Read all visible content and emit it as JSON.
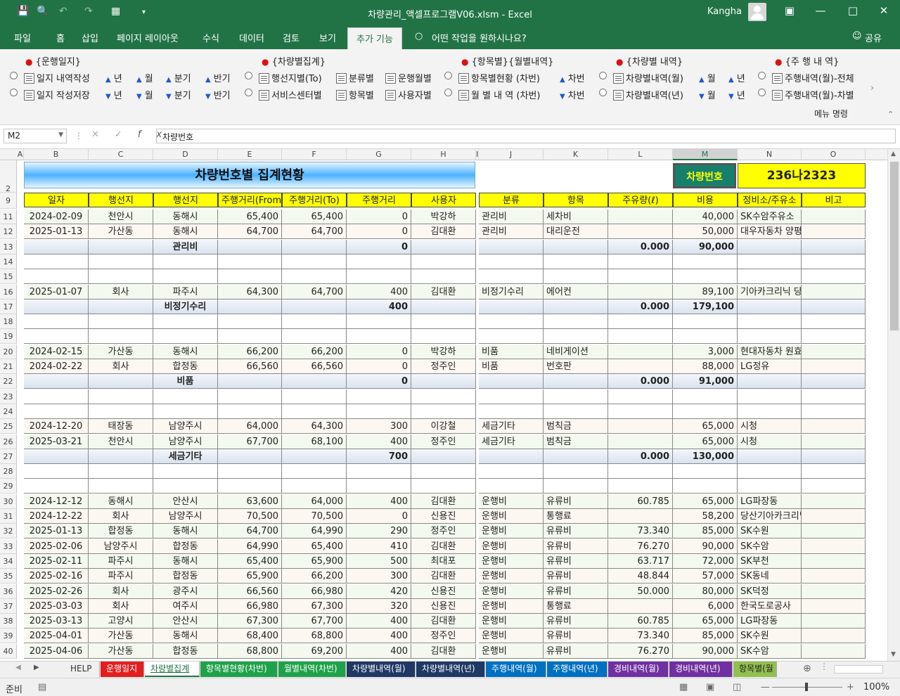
{
  "window": {
    "title": "차량관리_액셀프로그램V06.xlsm  -  Excel",
    "user": "Kangha"
  },
  "menu": {
    "tabs": [
      "파일",
      "홈",
      "삽입",
      "페이지 레이아웃",
      "수식",
      "데이터",
      "검토",
      "보기",
      "추가 기능"
    ],
    "active_tab": "추가 기능",
    "tell_me": "어떤 작업을 원하시나요?",
    "share": "공유"
  },
  "ribbon": {
    "groups": {
      "g1": "{운행일지}",
      "g2": "{차량별집계}",
      "g3": "{항목별}{월별내역}",
      "g4": "{차량별 내역}",
      "g5": "{주 행 내 역}"
    },
    "items": {
      "daily_write": "일지 내역작성",
      "daily_save": "일지 작성저장",
      "year": "년",
      "month": "월",
      "quarter": "분기",
      "half": "반기",
      "by_route_to": "행선지별(To)",
      "by_service": "서비스센터별",
      "by_class": "분류별",
      "by_item": "항목별",
      "by_run_month": "운행월별",
      "by_user": "사용자별",
      "item_status": "항목별현황 (차번)",
      "monthly_detail": "월 별 내 역 (차번)",
      "car_no": "차번",
      "car_monthly": "차량별내역(월)",
      "car_yearly": "차량별내역(년)",
      "run_month_all": "주행내역(월)-전체",
      "run_month_car": "주행내역(월)-차별"
    },
    "footer": "메뉴 명령"
  },
  "formula": {
    "namebox": "M2",
    "content": "차량번호"
  },
  "sheet": {
    "columns": [
      "A",
      "B",
      "C",
      "D",
      "E",
      "F",
      "G",
      "H",
      "I",
      "J",
      "K",
      "L",
      "M",
      "N",
      "O"
    ],
    "selected_column": "M",
    "title": "차량번호별 집계현황",
    "car_label": "차량번호",
    "car_value": "236나2323",
    "headers": [
      "일자",
      "행선지",
      "행선지",
      "주행거리(From)",
      "주행거리(To)",
      "주행거리",
      "사용자",
      "분류",
      "항목",
      "주유량(ℓ)",
      "비용",
      "정비소/주유소",
      "비고"
    ],
    "rows": [
      {
        "n": "11",
        "t": "d",
        "z": "a",
        "v": [
          "2024-02-09",
          "천안시",
          "동해시",
          "65,400",
          "65,400",
          "0",
          "박강하",
          "관리비",
          "세차비",
          "",
          "40,000",
          "SK수암주유소",
          ""
        ]
      },
      {
        "n": "12",
        "t": "d",
        "z": "b",
        "v": [
          "2025-01-13",
          "가산동",
          "동해시",
          "64,700",
          "64,700",
          "0",
          "김대환",
          "관리비",
          "대리운전",
          "",
          "50,000",
          "대우자동차 양평동",
          ""
        ]
      },
      {
        "n": "13",
        "t": "s",
        "v": [
          "",
          "",
          "관리비",
          "",
          "",
          "0",
          "",
          "",
          "",
          "0.000",
          "90,000",
          "",
          ""
        ]
      },
      {
        "n": "14",
        "t": "e"
      },
      {
        "n": "15",
        "t": "e"
      },
      {
        "n": "16",
        "t": "d",
        "z": "a",
        "v": [
          "2025-01-07",
          "회사",
          "파주시",
          "64,300",
          "64,700",
          "400",
          "김대환",
          "비정기수리",
          "에어컨",
          "",
          "89,100",
          "기아카크리닉 당산점",
          ""
        ]
      },
      {
        "n": "17",
        "t": "s",
        "v": [
          "",
          "",
          "비정기수리",
          "",
          "",
          "400",
          "",
          "",
          "",
          "0.000",
          "179,100",
          "",
          ""
        ]
      },
      {
        "n": "18",
        "t": "e"
      },
      {
        "n": "19",
        "t": "e"
      },
      {
        "n": "20",
        "t": "d",
        "z": "a",
        "v": [
          "2024-02-15",
          "가산동",
          "동해시",
          "66,200",
          "66,200",
          "0",
          "박강하",
          "비품",
          "네비게이션",
          "",
          "3,000",
          "현대자동차 원효로",
          ""
        ]
      },
      {
        "n": "21",
        "t": "d",
        "z": "b",
        "v": [
          "2024-02-22",
          "회사",
          "합정동",
          "66,560",
          "66,560",
          "0",
          "정주인",
          "비품",
          "번호판",
          "",
          "88,000",
          "LG정유",
          ""
        ]
      },
      {
        "n": "22",
        "t": "s",
        "v": [
          "",
          "",
          "비품",
          "",
          "",
          "0",
          "",
          "",
          "",
          "0.000",
          "91,000",
          "",
          ""
        ]
      },
      {
        "n": "23",
        "t": "e"
      },
      {
        "n": "24",
        "t": "e"
      },
      {
        "n": "25",
        "t": "d",
        "z": "b",
        "v": [
          "2024-12-20",
          "태장동",
          "남양주시",
          "64,000",
          "64,300",
          "300",
          "이강철",
          "세금기타",
          "범칙금",
          "",
          "65,000",
          "시청",
          ""
        ]
      },
      {
        "n": "26",
        "t": "d",
        "z": "a",
        "v": [
          "2025-03-21",
          "천안시",
          "남양주시",
          "67,700",
          "68,100",
          "400",
          "정주인",
          "세금기타",
          "범칙금",
          "",
          "65,000",
          "시청",
          ""
        ]
      },
      {
        "n": "27",
        "t": "s",
        "v": [
          "",
          "",
          "세금기타",
          "",
          "",
          "700",
          "",
          "",
          "",
          "0.000",
          "130,000",
          "",
          ""
        ]
      },
      {
        "n": "28",
        "t": "e"
      },
      {
        "n": "29",
        "t": "e"
      },
      {
        "n": "30",
        "t": "d",
        "z": "a",
        "v": [
          "2024-12-12",
          "동해시",
          "안산시",
          "63,600",
          "64,000",
          "400",
          "김대환",
          "운행비",
          "유류비",
          "60.785",
          "65,000",
          "LG파장동",
          ""
        ]
      },
      {
        "n": "31",
        "t": "d",
        "z": "b",
        "v": [
          "2024-12-22",
          "회사",
          "남양주시",
          "70,500",
          "70,500",
          "0",
          "신용진",
          "운행비",
          "통행료",
          "",
          "58,200",
          "당산기아카크리닉",
          ""
        ]
      },
      {
        "n": "32",
        "t": "d",
        "z": "a",
        "v": [
          "2025-01-13",
          "합정동",
          "동해시",
          "64,700",
          "64,990",
          "290",
          "정주인",
          "운행비",
          "유류비",
          "73.340",
          "85,000",
          "SK수원",
          ""
        ]
      },
      {
        "n": "33",
        "t": "d",
        "z": "b",
        "v": [
          "2025-02-06",
          "남양주시",
          "합정동",
          "64,990",
          "65,400",
          "410",
          "김대환",
          "운행비",
          "유류비",
          "76.270",
          "90,000",
          "SK수암",
          ""
        ]
      },
      {
        "n": "34",
        "t": "d",
        "z": "a",
        "v": [
          "2025-02-11",
          "파주시",
          "동해시",
          "65,400",
          "65,900",
          "500",
          "최대포",
          "운행비",
          "유류비",
          "63.717",
          "72,000",
          "SK부천",
          ""
        ]
      },
      {
        "n": "35",
        "t": "d",
        "z": "b",
        "v": [
          "2025-02-16",
          "파주시",
          "합정동",
          "65,900",
          "66,200",
          "300",
          "김대환",
          "운행비",
          "유류비",
          "48.844",
          "57,000",
          "SK동네",
          ""
        ]
      },
      {
        "n": "36",
        "t": "d",
        "z": "a",
        "v": [
          "2025-02-26",
          "회사",
          "광주시",
          "66,560",
          "66,980",
          "420",
          "신용진",
          "운행비",
          "유류비",
          "50.000",
          "80,000",
          "SK덕정",
          ""
        ]
      },
      {
        "n": "37",
        "t": "d",
        "z": "b",
        "v": [
          "2025-03-03",
          "회사",
          "여주시",
          "66,980",
          "67,300",
          "320",
          "신용진",
          "운행비",
          "통행료",
          "",
          "6,000",
          "한국도로공사",
          ""
        ]
      },
      {
        "n": "38",
        "t": "d",
        "z": "a",
        "v": [
          "2025-03-13",
          "고양시",
          "안산시",
          "67,300",
          "67,700",
          "400",
          "김대환",
          "운행비",
          "유류비",
          "60.785",
          "65,000",
          "LG파장동",
          ""
        ]
      },
      {
        "n": "39",
        "t": "d",
        "z": "b",
        "v": [
          "2025-04-01",
          "가산동",
          "동해시",
          "68,400",
          "68,800",
          "400",
          "정주인",
          "운행비",
          "유류비",
          "73.340",
          "85,000",
          "SK수원",
          ""
        ]
      },
      {
        "n": "40",
        "t": "d",
        "z": "a",
        "v": [
          "2025-04-06",
          "가산동",
          "합정동",
          "68,800",
          "69,200",
          "400",
          "김대환",
          "운행비",
          "유류비",
          "76.270",
          "90,000",
          "SK수암",
          ""
        ]
      }
    ]
  },
  "sheet_tabs": [
    {
      "label": "HELP",
      "color": "#f0f0f0",
      "fg": "#333"
    },
    {
      "label": "운행일지",
      "color": "#e41e1e",
      "fg": "#ffffff"
    },
    {
      "label": "차량별집계",
      "color": "#ffffff",
      "fg": "#217346"
    },
    {
      "label": "항목별현황(차번)",
      "color": "#1fa14a",
      "fg": "#ffffff"
    },
    {
      "label": "월별내역(차번)",
      "color": "#1fa14a",
      "fg": "#ffffff"
    },
    {
      "label": "차량별내역(월)",
      "color": "#1f3864",
      "fg": "#ffffff"
    },
    {
      "label": "차량별내역(년)",
      "color": "#1f3864",
      "fg": "#ffffff"
    },
    {
      "label": "주행내역(월)",
      "color": "#0070c0",
      "fg": "#ffffff"
    },
    {
      "label": "주행내역(년)",
      "color": "#0070c0",
      "fg": "#ffffff"
    },
    {
      "label": "경비내역(월)",
      "color": "#7030a0",
      "fg": "#ffffff"
    },
    {
      "label": "경비내역(년)",
      "color": "#7030a0",
      "fg": "#ffffff"
    },
    {
      "label": "항목별(월",
      "color": "#92c050",
      "fg": "#222222"
    }
  ],
  "status": {
    "ready": "준비",
    "zoom": "100%"
  },
  "colors": {
    "accent": "#217346"
  }
}
